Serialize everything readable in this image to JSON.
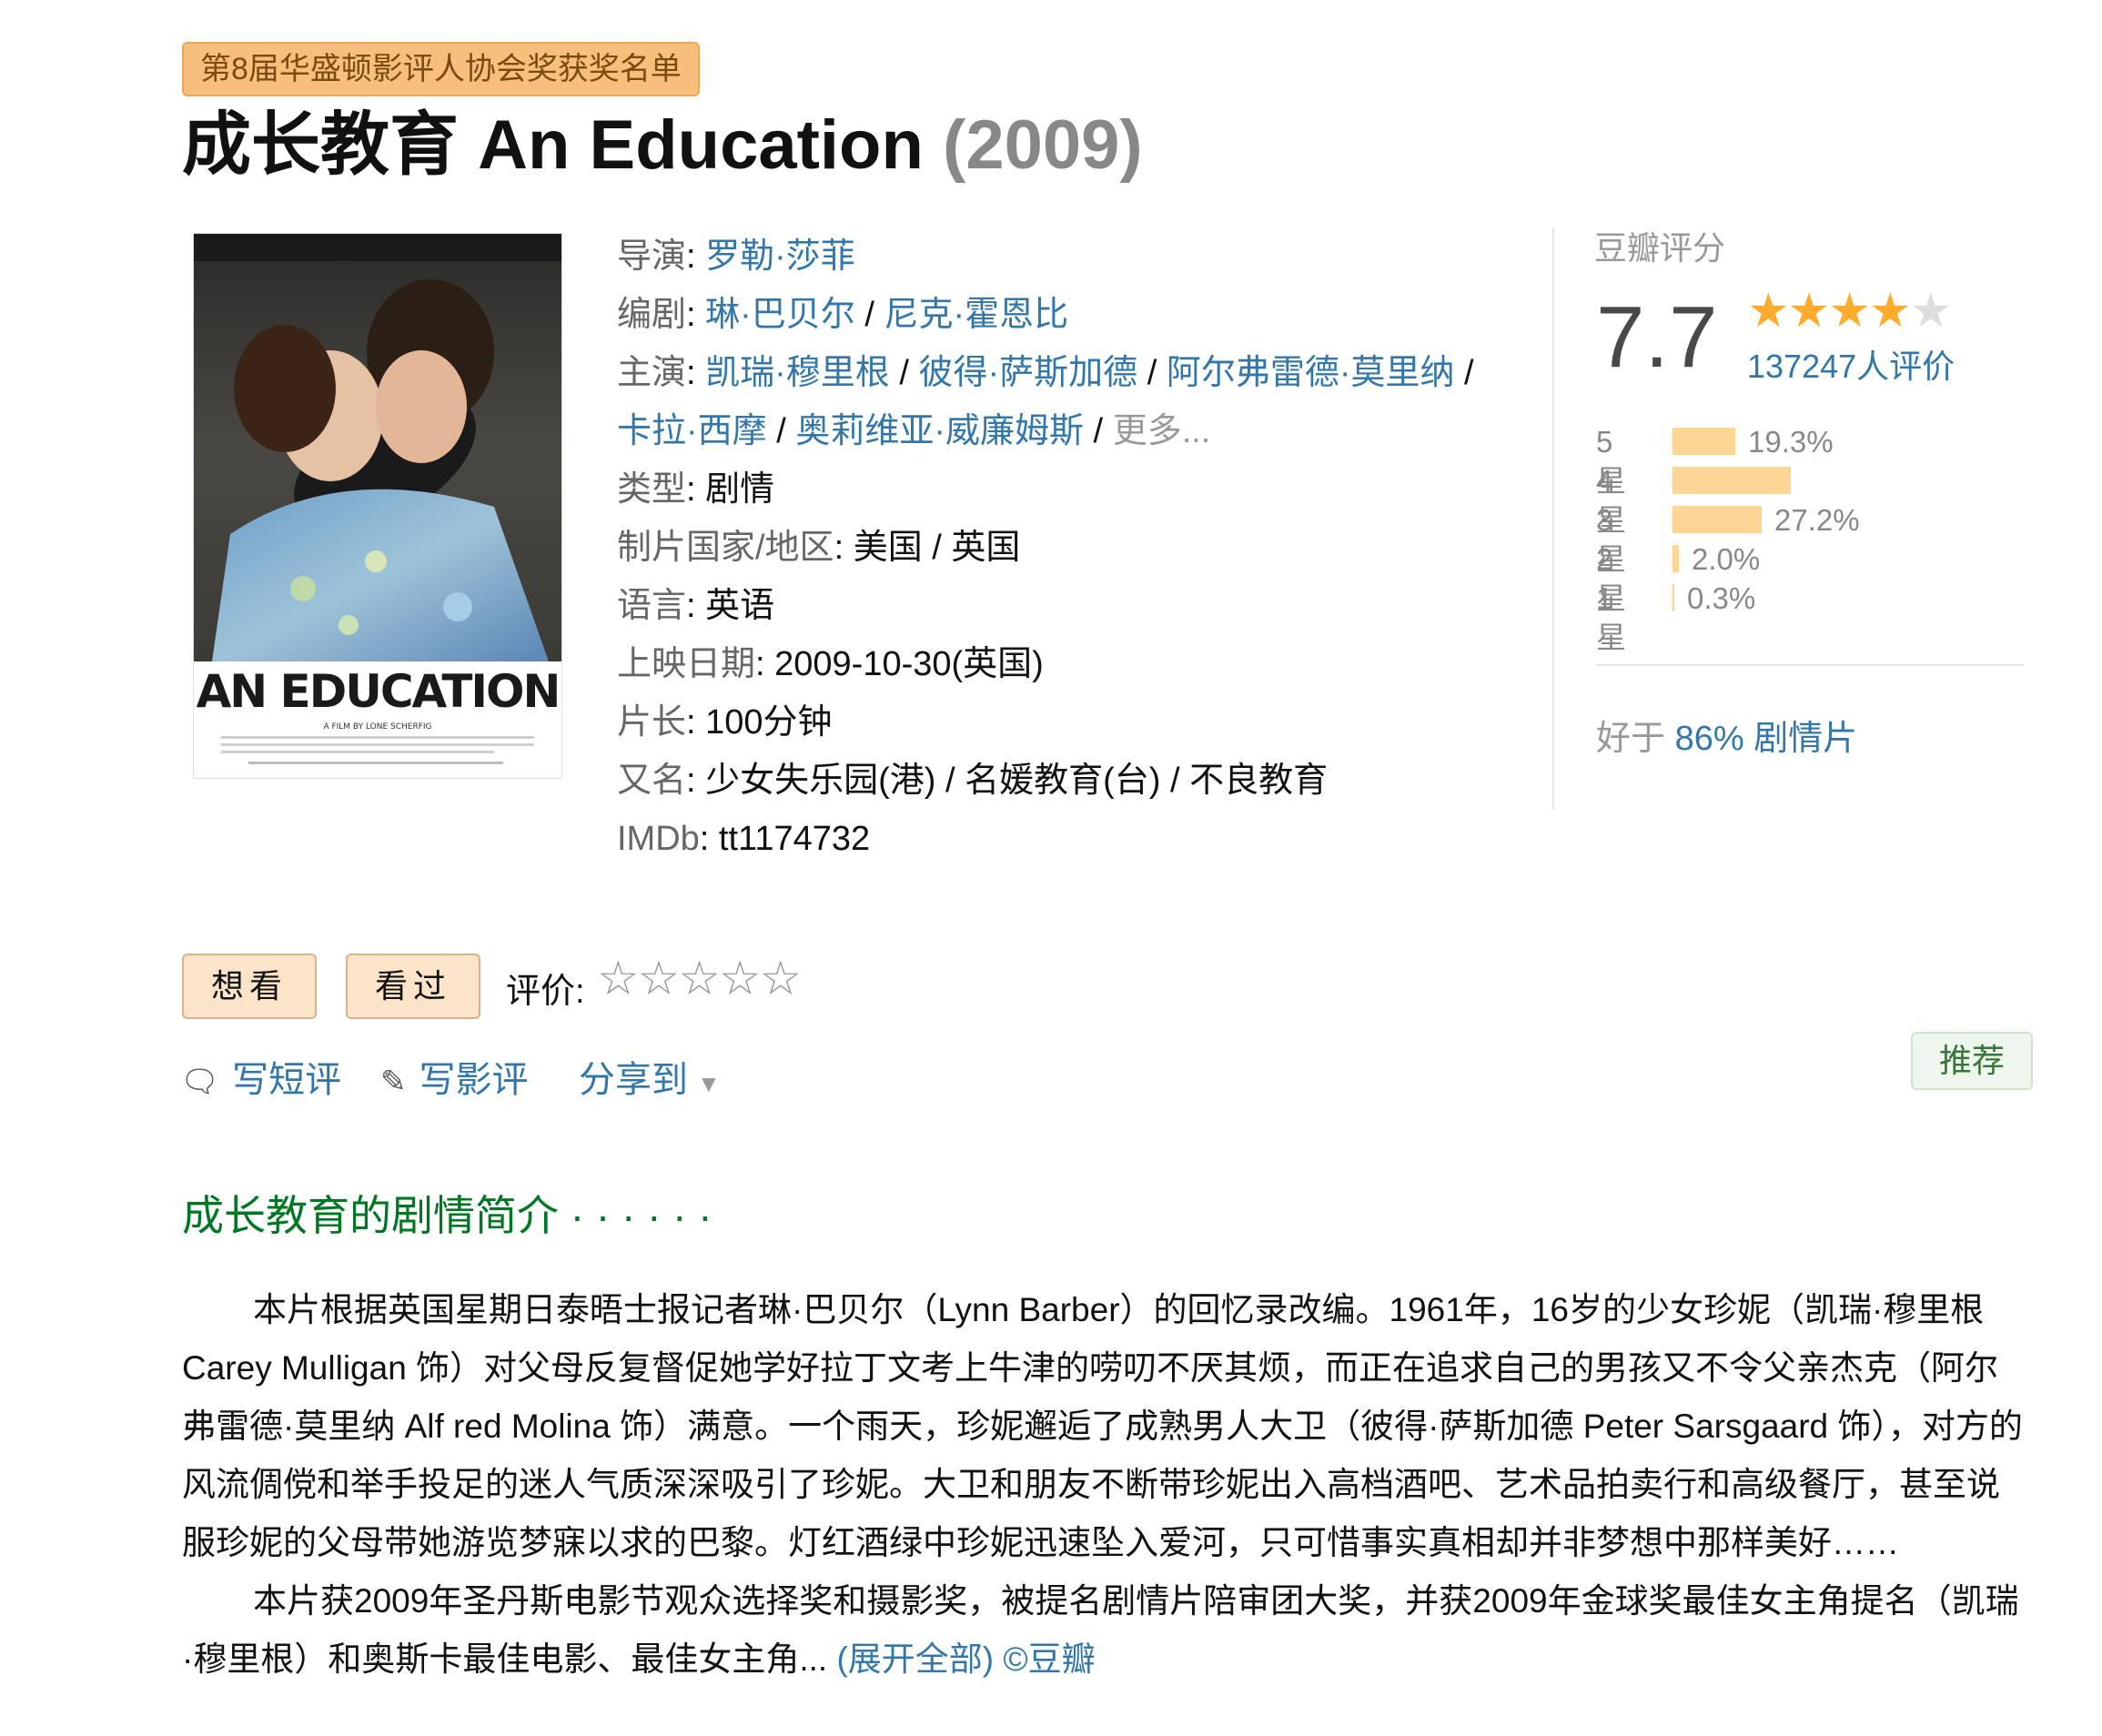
{
  "badge": "第8届华盛顿影评人协会奖获奖名单",
  "title": {
    "cn": "成长教育",
    "en": "An Education",
    "year": "(2009)"
  },
  "poster": {
    "title_text": "AN EDUCATION",
    "credit_text": "A FILM BY LONE SCHERFIG",
    "actors": [
      "PETER SARSGAARD",
      "ALFRED MOLINA",
      "ROSAMUND PIKE",
      "DOMINIC COOPER",
      "OLIVIA WILLIAMS",
      "EMMA THOMPSON",
      "CAREY MULLIGAN"
    ]
  },
  "info": {
    "director_label": "导演",
    "director": "罗勒·莎菲",
    "writer_label": "编剧",
    "writers": [
      "琳·巴贝尔",
      "尼克·霍恩比"
    ],
    "cast_label": "主演",
    "cast": [
      "凯瑞·穆里根",
      "彼得·萨斯加德",
      "阿尔弗雷德·莫里纳",
      "卡拉·西摩",
      "奥莉维亚·威廉姆斯"
    ],
    "more": "更多...",
    "genre_label": "类型",
    "genre": "剧情",
    "country_label": "制片国家/地区",
    "country": "美国 / 英国",
    "language_label": "语言",
    "language": "英语",
    "release_label": "上映日期",
    "release": "2009-10-30(英国)",
    "runtime_label": "片长",
    "runtime": "100分钟",
    "aka_label": "又名",
    "aka": "少女失乐园(港) / 名媛教育(台) / 不良教育",
    "imdb_label": "IMDb",
    "imdb": "tt1174732",
    "sep": " / ",
    "colon": ": "
  },
  "rating": {
    "label": "豆瓣评分",
    "score": "7.7",
    "stars_filled": 4,
    "stars_total": 5,
    "votes": "137247人评价",
    "distribution": [
      {
        "star": "5星",
        "fraction": 0.193,
        "pct": "19.3%"
      },
      {
        "star": "4星",
        "fraction": 0.36,
        "pct": ""
      },
      {
        "star": "3星",
        "fraction": 0.272,
        "pct": "27.2%"
      },
      {
        "star": "2星",
        "fraction": 0.02,
        "pct": "2.0%"
      },
      {
        "star": "1星",
        "fraction": 0.003,
        "pct": "0.3%"
      }
    ],
    "better_prefix": "好于",
    "better_pct": "86%",
    "better_genre": "剧情片"
  },
  "actions": {
    "want": "想看",
    "seen": "看过",
    "rate_label": "评价:",
    "rate_stars": "☆☆☆☆☆",
    "write_short": "写短评",
    "write_review": "写影评",
    "share": "分享到",
    "recommend": "推荐"
  },
  "summary": {
    "heading": "成长教育的剧情简介 · · · · · ·",
    "para1": "本片根据英国星期日泰晤士报记者琳·巴贝尔（Lynn Barber）的回忆录改编。1961年，16岁的少女珍妮（凯瑞·穆里根 Carey Mulligan 饰）对父母反复督促她学好拉丁文考上牛津的唠叨不厌其烦，而正在追求自己的男孩又不令父亲杰克（阿尔弗雷德·莫里纳 Alf red Molina 饰）满意。一个雨天，珍妮邂逅了成熟男人大卫（彼得·萨斯加德 Peter Sarsgaard 饰），对方的风流倜傥和举手投足的迷人气质深深吸引了珍妮。大卫和朋友不断带珍妮出入高档酒吧、艺术品拍卖行和高级餐厅，甚至说服珍妮的父母带她游览梦寐以求的巴黎。灯红酒绿中珍妮迅速坠入爱河，只可惜事实真相却并非梦想中那样美好……",
    "para2": "本片获2009年圣丹斯电影节观众选择奖和摄影奖，被提名剧情片陪审团大奖，并获2009年金球奖最佳女主角提名（凯瑞·穆里根）和奥斯卡最佳电影、最佳女主角...",
    "expand": "(展开全部)",
    "source": "©豆瓣"
  }
}
